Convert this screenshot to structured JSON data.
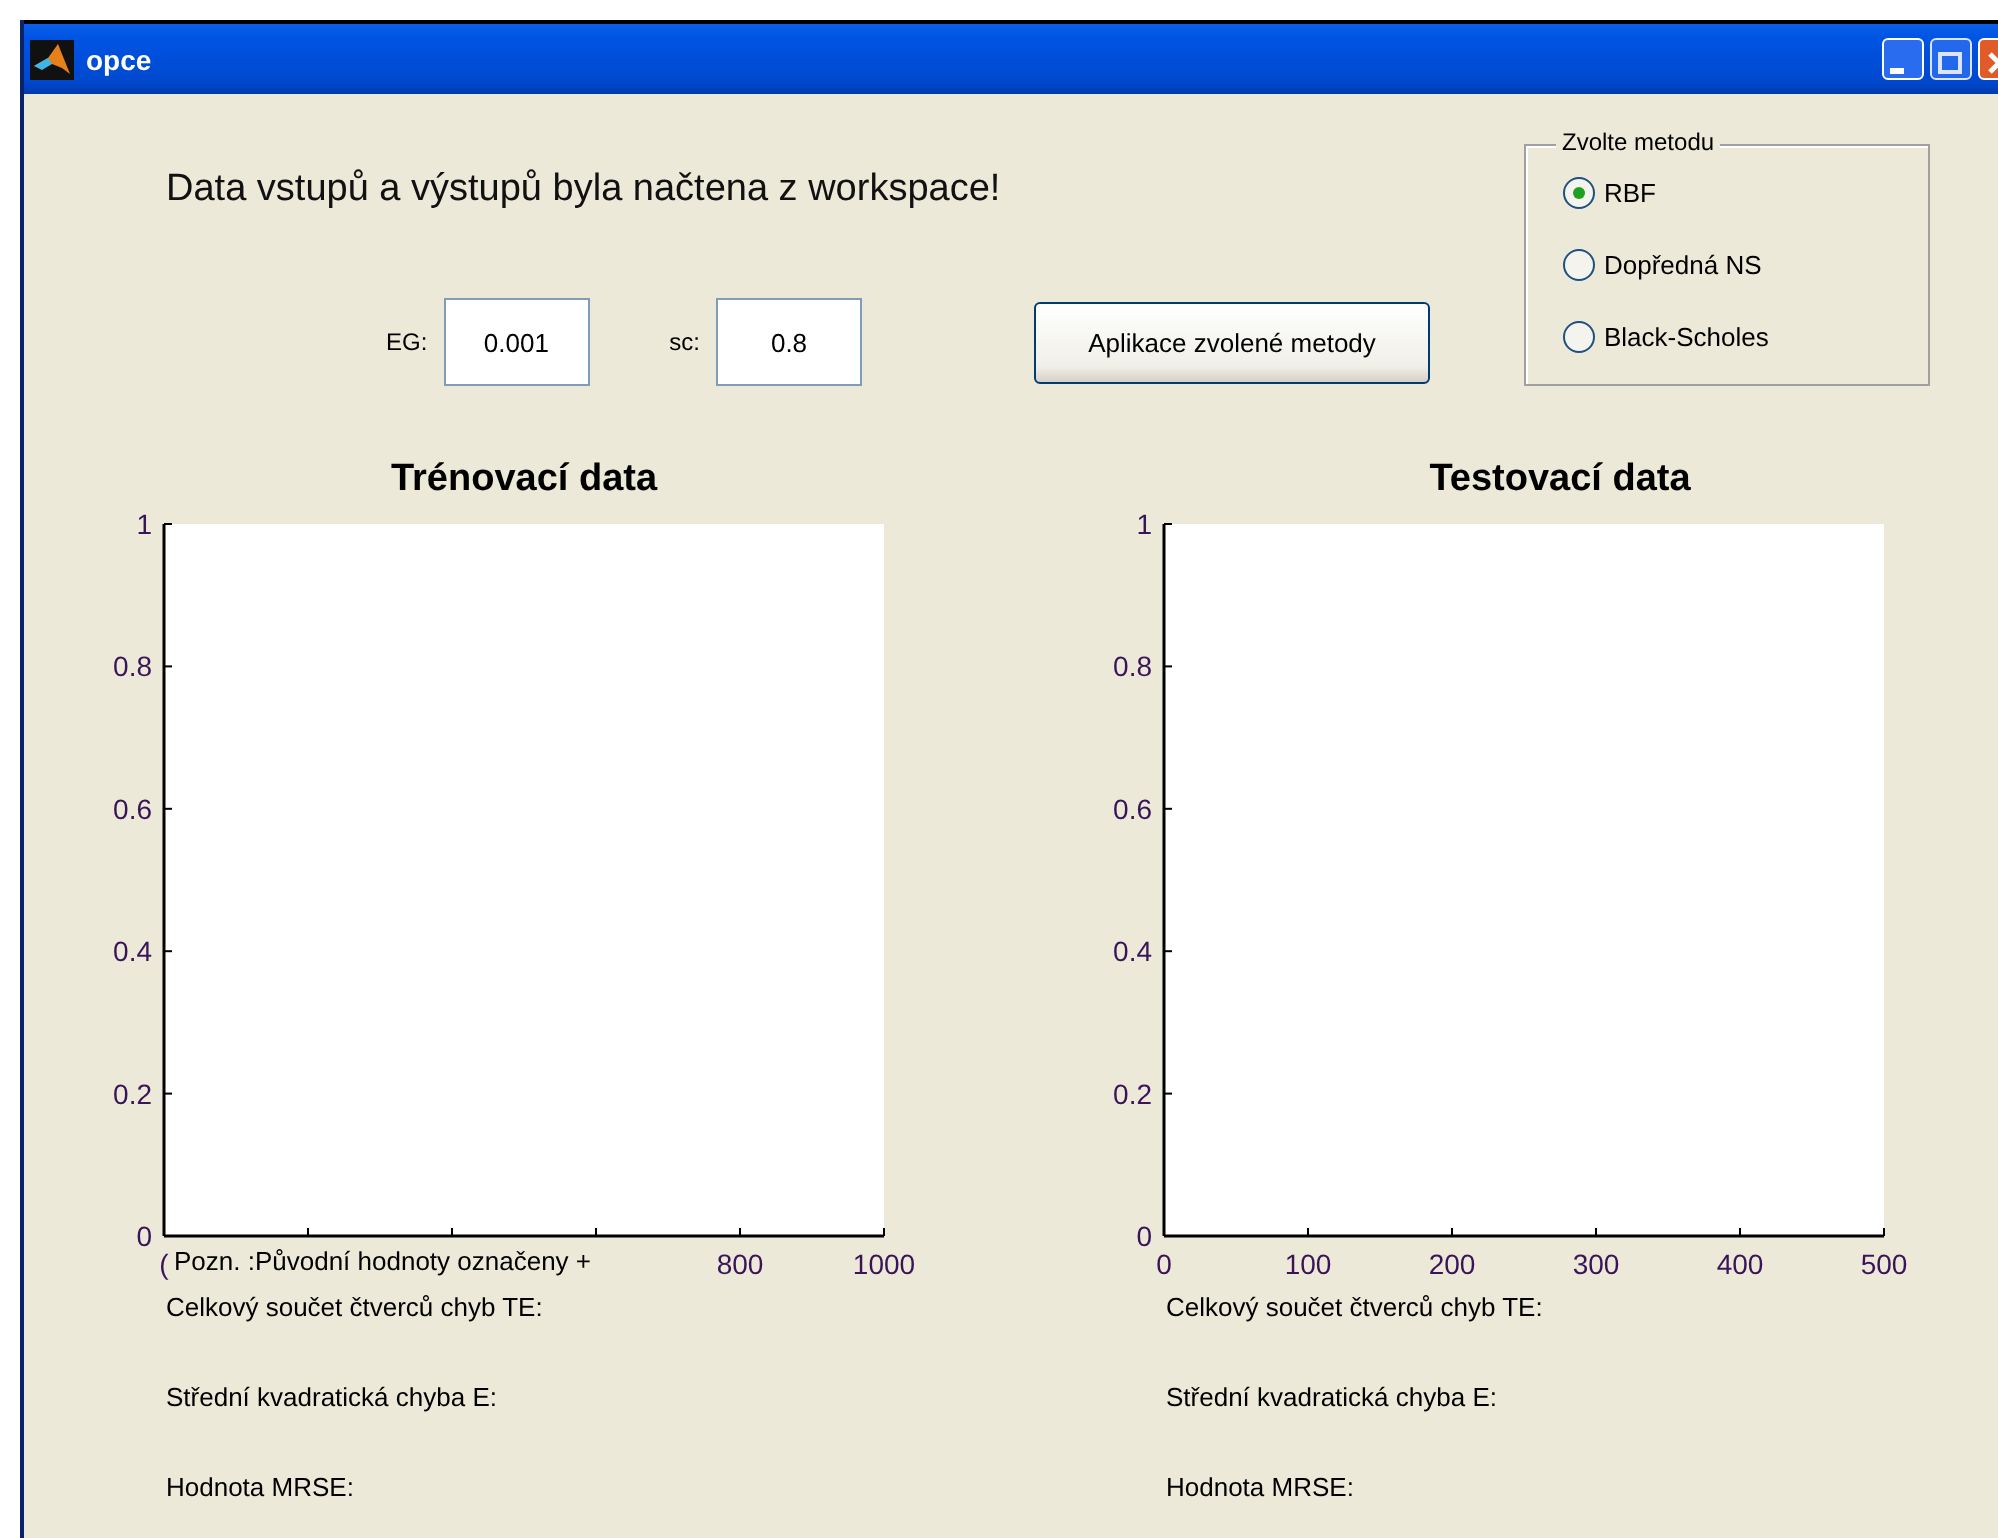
{
  "window": {
    "title": "opce"
  },
  "message": "Data vstupů a výstupů byla načtena z workspace!",
  "parameters": [
    {
      "label": "EG:",
      "value": "0.001"
    },
    {
      "label": "sc:",
      "value": "0.8"
    }
  ],
  "apply_button": "Aplikace zvolené metody",
  "method_group": {
    "title": "Zvolte metodu",
    "options": [
      {
        "label": "RBF",
        "selected": true
      },
      {
        "label": "Dopředná NS",
        "selected": false
      },
      {
        "label": "Black-Scholes",
        "selected": false
      }
    ]
  },
  "charts": [
    {
      "title": "Trénovací data",
      "note": "Pozn. :Původní hodnoty označeny +",
      "chart_data": {
        "type": "line",
        "xlim": [
          0,
          1000
        ],
        "ylim": [
          0,
          1
        ],
        "xticks": [
          {
            "value": 0,
            "label": "("
          },
          800,
          1000
        ],
        "yticks": [
          0,
          0.2,
          0.4,
          0.6,
          0.8,
          1
        ]
      },
      "stats": [
        "Celkový součet čtverců chyb TE:",
        "Střední kvadratická chyba E:",
        "Hodnota MRSE:"
      ]
    },
    {
      "title": "Testovací data",
      "chart_data": {
        "type": "line",
        "xlim": [
          0,
          500
        ],
        "ylim": [
          0,
          1
        ],
        "xticks": [
          0,
          100,
          200,
          300,
          400,
          500
        ],
        "yticks": [
          0,
          0.2,
          0.4,
          0.6,
          0.8,
          1
        ]
      },
      "stats": [
        "Celkový součet čtverců chyb TE:",
        "Střední kvadratická chyba E:",
        "Hodnota MRSE:"
      ]
    }
  ]
}
